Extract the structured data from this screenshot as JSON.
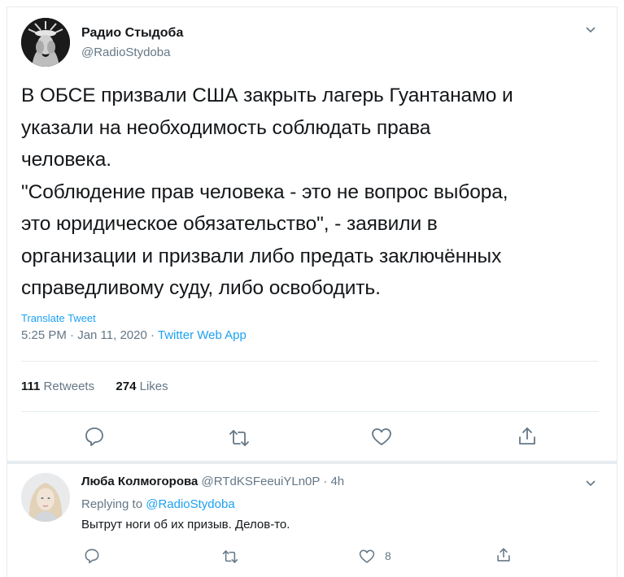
{
  "tweet": {
    "author_name": "Радио Стыдоба",
    "author_handle": "@RadioStydoba",
    "text": "В ОБСЕ призвали США закрыть лагерь Гуантанамо и\nуказали на необходимость соблюдать права\nчеловека.\n\"Соблюдение прав человека - это не вопрос выбора,\nэто юридическое обязательство\", - заявили в\nорганизации и призвали либо предать заключённых\nсправедливому суду, либо освободить.",
    "translate_label": "Translate Tweet",
    "time": "5:25 PM · Jan 11, 2020 · ",
    "source_app": "Twitter Web App",
    "retweets_count": "111",
    "retweets_label": "Retweets",
    "likes_count": "274",
    "likes_label": "Likes"
  },
  "reply": {
    "author_name": "Люба Колмогорова",
    "author_handle": "@RTdKSFeeuiYLn0P",
    "age": "4h",
    "replying_prefix": "Replying to ",
    "replying_to": "@RadioStydoba",
    "text": "Вытрут ноги об их призыв. Делов-то.",
    "likes_count": "8"
  },
  "icons": {
    "reply": "reply-icon",
    "retweet": "retweet-icon",
    "like": "heart-icon",
    "share": "share-icon",
    "more": "chevron-down-icon"
  },
  "colors": {
    "accent": "#1da1f2",
    "secondary_text": "#657786",
    "primary_text": "#14171a",
    "divider": "#e6ecf0"
  }
}
